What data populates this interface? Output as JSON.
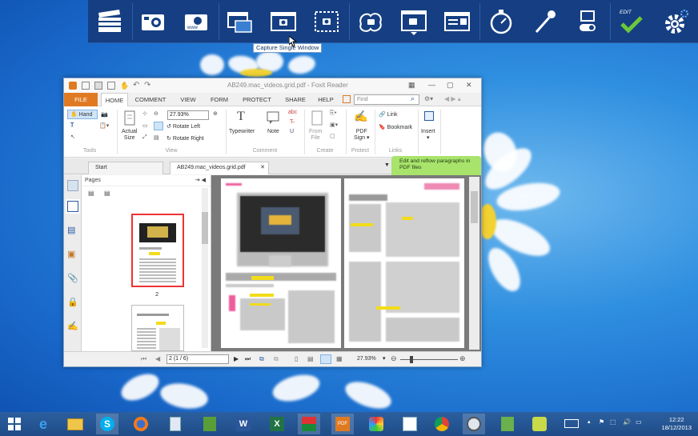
{
  "toolbar": {
    "buttons": [
      {
        "name": "clapper-icon"
      },
      {
        "name": "capture-region-icon"
      },
      {
        "name": "capture-website-icon"
      },
      {
        "name": "capture-window-multi-icon"
      },
      {
        "name": "capture-single-window-icon"
      },
      {
        "name": "capture-dashed-region-icon"
      },
      {
        "name": "capture-freehand-icon"
      },
      {
        "name": "capture-scrolling-icon"
      },
      {
        "name": "capture-menu-icon"
      },
      {
        "name": "timer-icon"
      },
      {
        "name": "color-picker-icon"
      },
      {
        "name": "toggle-icon"
      },
      {
        "name": "edit-check-icon"
      },
      {
        "name": "gear-icon"
      }
    ],
    "edit_label": "EDIT"
  },
  "tooltip": "Capture Single Window",
  "window": {
    "title": "AB249.mac_videos.grid.pdf - Foxit Reader",
    "menu_tabs": [
      "FILE",
      "HOME",
      "COMMENT",
      "VIEW",
      "FORM",
      "PROTECT",
      "SHARE",
      "HELP"
    ],
    "find_placeholder": "Find",
    "ribbon": {
      "hand": "Hand",
      "actual_size_l1": "Actual",
      "actual_size_l2": "Size",
      "zoom_value": "27.93%",
      "rotate_left": "Rotate Left",
      "rotate_right": "Rotate Right",
      "typewriter": "Typewriter",
      "note": "Note",
      "from_file_l1": "From",
      "from_file_l2": "File",
      "pdf_sign_l1": "PDF",
      "pdf_sign_l2": "Sign",
      "link": "Link",
      "bookmark": "Bookmark",
      "insert": "Insert",
      "groups": [
        "Tools",
        "View",
        "Comment",
        "Create",
        "Protect",
        "Links"
      ]
    },
    "tabs": [
      "Start",
      "AB249.mac_videos.grid.pdf"
    ],
    "hint": "Edit and reflow paragraphs in PDF files",
    "pages_header": "Pages",
    "thumb_label": "2",
    "status": {
      "page": "2 (1 / 6)",
      "zoom": "27.93%"
    }
  },
  "clock": {
    "time": "12:22",
    "date": "18/12/2013"
  },
  "colors": {
    "foxit_orange": "#e07a22",
    "toolbar_bg": "#153f82"
  }
}
